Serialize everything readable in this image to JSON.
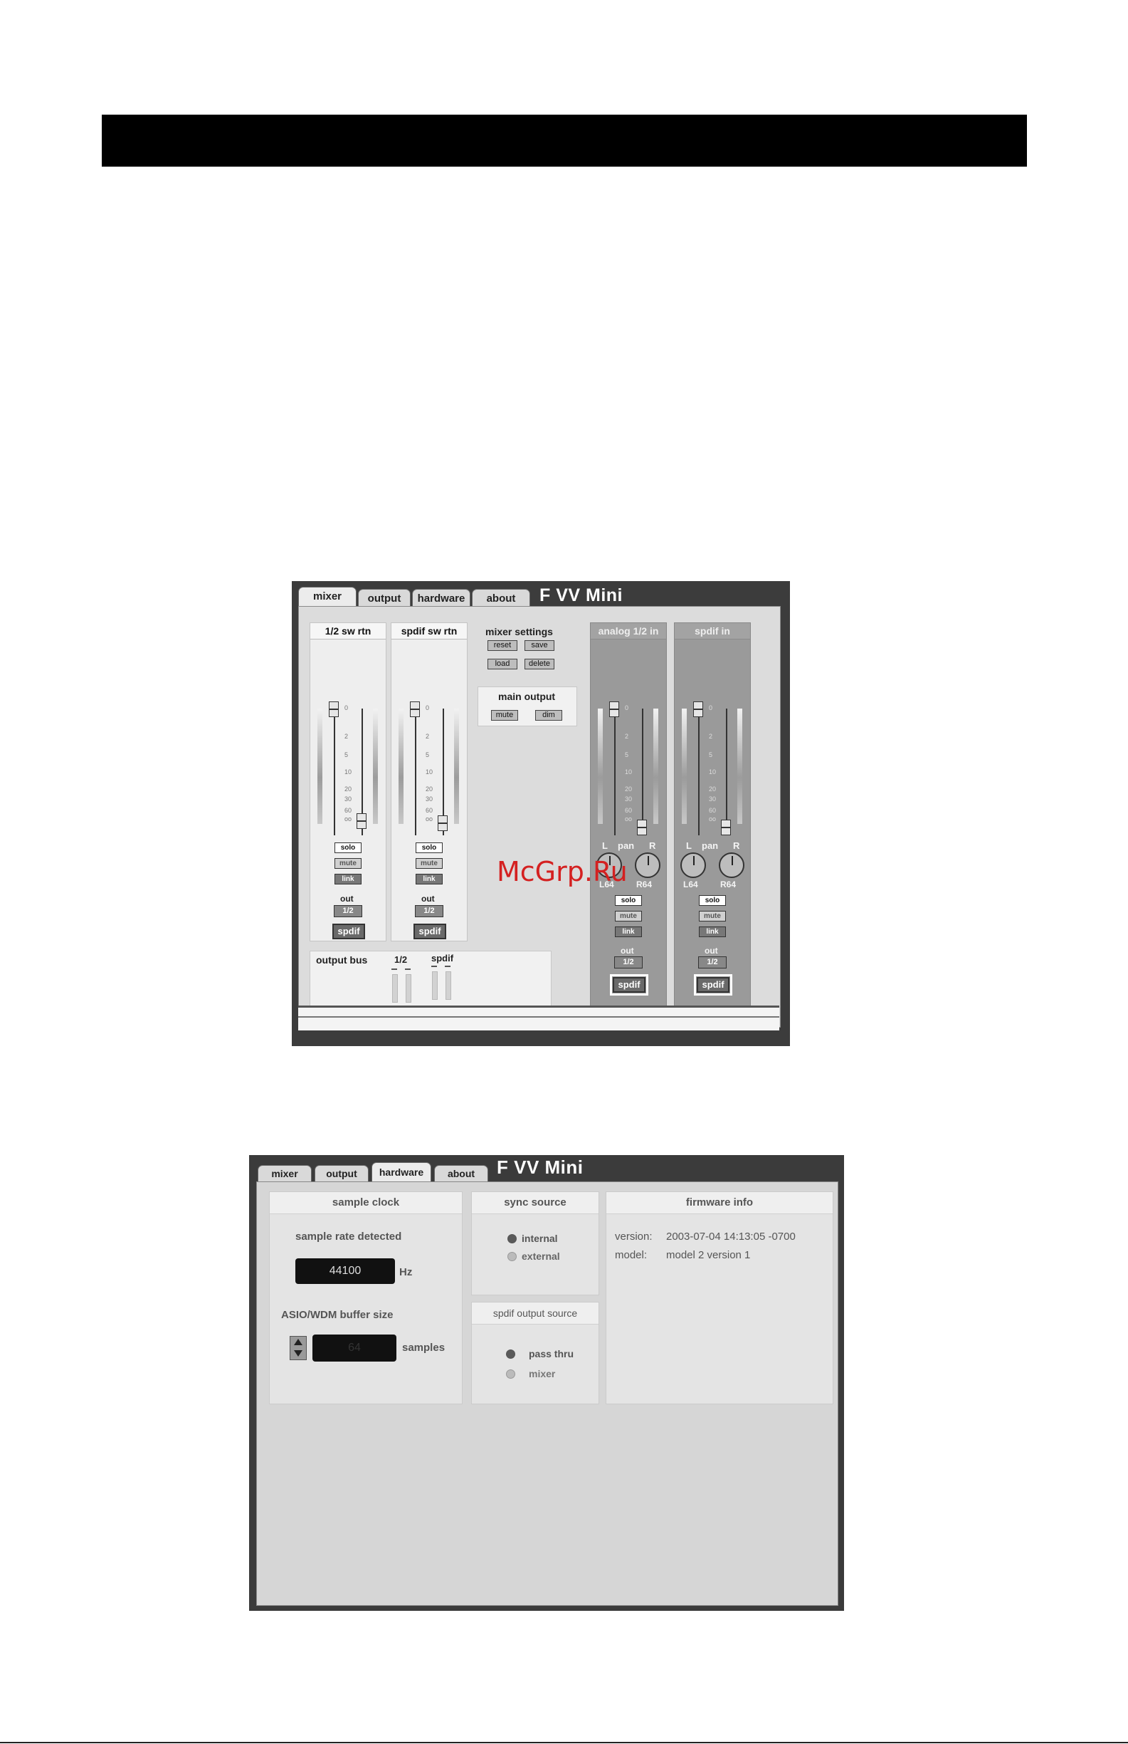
{
  "watermark": "McGrp.Ru",
  "mixer_window": {
    "tabs": [
      "mixer",
      "output",
      "hardware",
      "about"
    ],
    "active_tab": "mixer",
    "brand": "F VV Mini",
    "channels": [
      {
        "title": "1/2 sw rtn",
        "solo": "solo",
        "mute": "mute",
        "link": "link",
        "out_label": "out",
        "out_value": "1/2",
        "spdif": "spdif"
      },
      {
        "title": "spdif sw rtn",
        "solo": "solo",
        "mute": "mute",
        "link": "link",
        "out_label": "out",
        "out_value": "1/2",
        "spdif": "spdif"
      },
      {
        "title": "analog 1/2 in",
        "pan_l": "L",
        "pan_label": "pan",
        "pan_r": "R",
        "pan_left_value": "L64",
        "pan_right_value": "R64",
        "solo": "solo",
        "mute": "mute",
        "link": "link",
        "out_label": "out",
        "out_value": "1/2",
        "spdif": "spdif"
      },
      {
        "title": "spdif in",
        "pan_l": "L",
        "pan_label": "pan",
        "pan_r": "R",
        "pan_left_value": "L64",
        "pan_right_value": "R64",
        "solo": "solo",
        "mute": "mute",
        "link": "link",
        "out_label": "out",
        "out_value": "1/2",
        "spdif": "spdif"
      }
    ],
    "fader_scale": [
      "0",
      "2",
      "5",
      "10",
      "20",
      "30",
      "60",
      "oo"
    ],
    "mixer_settings": {
      "title": "mixer settings",
      "reset": "reset",
      "save": "save",
      "load": "load",
      "delete": "delete"
    },
    "main_output": {
      "title": "main output",
      "mute": "mute",
      "dim": "dim"
    },
    "output_bus": {
      "title": "output bus",
      "col1": "1/2",
      "col2": "spdif"
    }
  },
  "hardware_window": {
    "tabs": [
      "mixer",
      "output",
      "hardware",
      "about"
    ],
    "active_tab": "hardware",
    "brand": "F VV Mini",
    "sample_clock": {
      "title": "sample clock",
      "rate_label": "sample rate detected",
      "rate_value": "44100",
      "rate_unit": "Hz",
      "buffer_label": "ASIO/WDM buffer size",
      "buffer_value": "64",
      "buffer_unit": "samples"
    },
    "sync_source": {
      "title": "sync source",
      "options": [
        "internal",
        "external"
      ],
      "selected": "internal"
    },
    "spdif_output_source": {
      "title": "spdif  output  source",
      "options": [
        "pass thru",
        "mixer"
      ],
      "selected": "pass thru"
    },
    "firmware_info": {
      "title": "firmware info",
      "version_label": "version:",
      "version_value": "2003-07-04 14:13:05 -0700",
      "model_label": "model:",
      "model_value": "model 2 version 1"
    }
  }
}
